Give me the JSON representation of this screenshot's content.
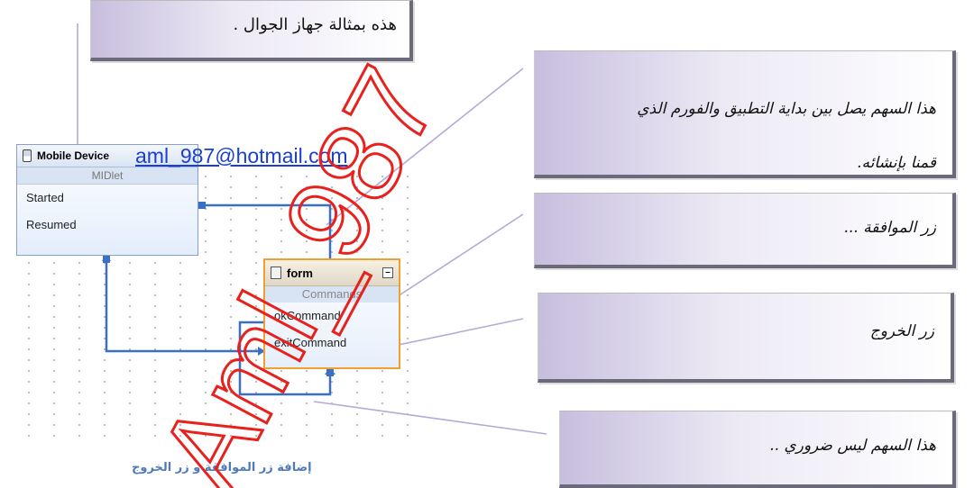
{
  "top_callout": {
    "text": "هذه بمثالة جهاز الجوال ."
  },
  "arrow_callout": {
    "line1": "هذا السهم يصل بين بداية التطبيق والفورم الذي",
    "line2": "قمنا بإنشائه."
  },
  "ok_callout": {
    "text": "زر الموافقة ..."
  },
  "exit_callout": {
    "text": "زر الخروج"
  },
  "notneeded_callout": {
    "text": "هذا السهم ليس ضروري .."
  },
  "mobile_node": {
    "title": "Mobile Device",
    "section": "MIDlet",
    "rows": [
      "Started",
      "Resumed"
    ]
  },
  "form_node": {
    "title": "form",
    "section": "Commands",
    "rows": [
      "okCommand",
      "exitCommand"
    ]
  },
  "email": "aml_987@hotmail.com",
  "watermark": "Aml_987",
  "caption": "إضافة زر الموافقة و زر الخروج",
  "colors": {
    "watermark": "#e8211d",
    "flow_lines": "#3a6fc4",
    "form_border": "#f0a030",
    "caption": "#5079b8"
  }
}
